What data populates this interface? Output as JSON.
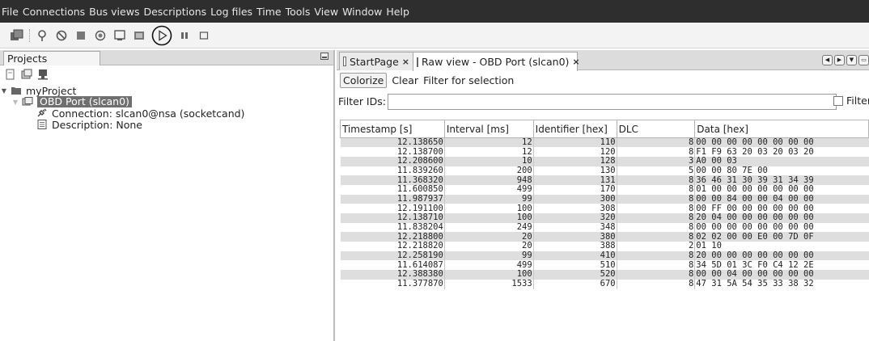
{
  "menubar": {
    "items": [
      "File",
      "Connections",
      "Bus views",
      "Descriptions",
      "Log files",
      "Time",
      "Tools",
      "View",
      "Window",
      "Help"
    ]
  },
  "toolbar": {
    "icons": [
      "new-project-icon",
      "connect-icon",
      "disconnect-icon",
      "stop-icon",
      "record-icon",
      "save-icon",
      "image-icon",
      "play-icon",
      "pause-icon",
      "clear-icon"
    ]
  },
  "projects_panel": {
    "tab_label": "Projects",
    "tree": {
      "project": "myProject",
      "port": "OBD Port (slcan0)",
      "connection": "Connection: slcan0@nsa (socketcand)",
      "description": "Description: None"
    }
  },
  "editor": {
    "tabs": [
      {
        "label": "StartPage"
      },
      {
        "label": "Raw view - OBD Port (slcan0)"
      }
    ],
    "actions": {
      "colorize": "Colorize",
      "clear": "Clear",
      "filter_for_selection": "Filter for selection"
    },
    "filter": {
      "label": "Filter IDs:",
      "value": "",
      "checkbox_label": "Filter"
    },
    "table": {
      "columns": [
        "Timestamp [s]",
        "Interval [ms]",
        "Identifier [hex]",
        "DLC",
        "Data [hex]"
      ],
      "rows": [
        [
          "12.138650",
          "12",
          "110",
          "8",
          "00 00 00 00 00 00 00 00"
        ],
        [
          "12.138700",
          "12",
          "120",
          "8",
          "F1 F9 63 20 03 20 03 20"
        ],
        [
          "12.208600",
          "10",
          "128",
          "3",
          "A0 00 03"
        ],
        [
          "11.839260",
          "200",
          "130",
          "5",
          "00 00 80 7E 00"
        ],
        [
          "11.368320",
          "948",
          "131",
          "8",
          "36 46 31 30 39 31 34 39"
        ],
        [
          "11.600850",
          "499",
          "170",
          "8",
          "01 00 00 00 00 00 00 00"
        ],
        [
          "11.987937",
          "99",
          "300",
          "8",
          "00 00 84 00 00 04 00 00"
        ],
        [
          "12.191100",
          "100",
          "308",
          "8",
          "00 FF 00 00 00 00 00 00"
        ],
        [
          "12.138710",
          "100",
          "320",
          "8",
          "20 04 00 00 00 00 00 00"
        ],
        [
          "11.838204",
          "249",
          "348",
          "8",
          "00 00 00 00 00 00 00 00"
        ],
        [
          "12.218800",
          "20",
          "380",
          "8",
          "02 02 00 00 E0 00 7D 0F"
        ],
        [
          "12.218820",
          "20",
          "388",
          "2",
          "01 10"
        ],
        [
          "12.258190",
          "99",
          "410",
          "8",
          "20 00 00 00 00 00 00 00"
        ],
        [
          "11.614087",
          "499",
          "510",
          "8",
          "34 5D 01 3C F0 C4 12 2E"
        ],
        [
          "12.388380",
          "100",
          "520",
          "8",
          "00 00 04 00 00 00 00 00"
        ],
        [
          "11.377870",
          "1533",
          "670",
          "8",
          "47 31 5A 54 35 33 38 32"
        ]
      ]
    }
  }
}
